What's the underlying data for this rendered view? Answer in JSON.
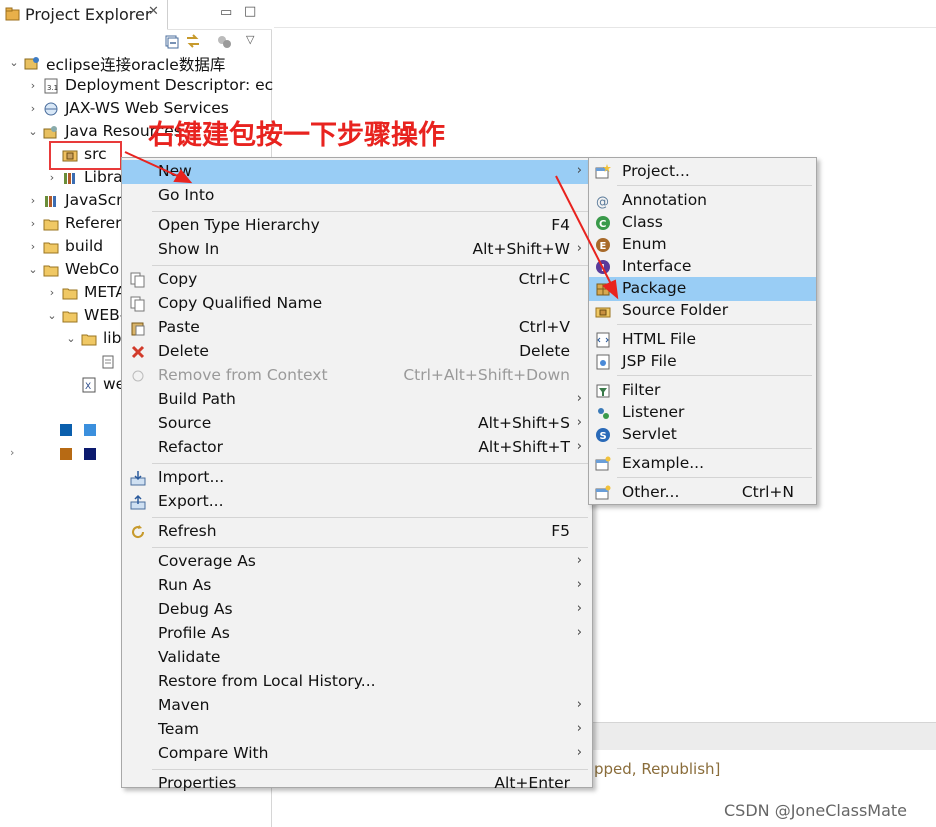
{
  "explorer": {
    "title": "Project Explorer",
    "close_glyph": "✕",
    "minimize_glyph": "▭",
    "maximize_glyph": "□"
  },
  "tree": [
    {
      "label": "eclipse连接oracle数据库",
      "icon": "project-icon",
      "expanded": true
    },
    {
      "label": "Deployment Descriptor: ecl",
      "icon": "descriptor-icon",
      "expanded": false
    },
    {
      "label": "JAX-WS Web Services",
      "icon": "webservices-icon",
      "expanded": false
    },
    {
      "label": "Java Resources",
      "icon": "java-resources-icon",
      "expanded": true
    },
    {
      "label": "src",
      "icon": "package-folder-icon"
    },
    {
      "label": "Libra",
      "icon": "library-icon",
      "expanded": false
    },
    {
      "label": "JavaScr",
      "icon": "library-icon",
      "expanded": false
    },
    {
      "label": "Referer",
      "icon": "folder-icon",
      "expanded": false
    },
    {
      "label": "build",
      "icon": "folder-icon",
      "expanded": false
    },
    {
      "label": "WebCo",
      "icon": "folder-icon",
      "expanded": true
    },
    {
      "label": "META",
      "icon": "folder-icon",
      "expanded": false
    },
    {
      "label": "WEB-",
      "icon": "folder-icon",
      "expanded": true
    },
    {
      "label": "lib",
      "icon": "folder-icon",
      "expanded": true
    },
    {
      "label": "",
      "icon": "jar-icon"
    },
    {
      "label": "we",
      "icon": "xml-file-icon"
    }
  ],
  "annotation": {
    "text": "右键建包按一下步骤操作",
    "color": "#e8231f"
  },
  "main_menu": [
    {
      "label": "New",
      "shortcut": "",
      "submenu": true,
      "highlighted": true,
      "icon": ""
    },
    {
      "label": "Go Into",
      "shortcut": "",
      "submenu": false,
      "icon": ""
    },
    {
      "sep": true
    },
    {
      "label": "Open Type Hierarchy",
      "shortcut": "F4",
      "submenu": false,
      "icon": ""
    },
    {
      "label": "Show In",
      "shortcut": "Alt+Shift+W",
      "submenu": true,
      "icon": ""
    },
    {
      "sep": true
    },
    {
      "label": "Copy",
      "shortcut": "Ctrl+C",
      "submenu": false,
      "icon": "copy-icon"
    },
    {
      "label": "Copy Qualified Name",
      "shortcut": "",
      "submenu": false,
      "icon": "copy-icon"
    },
    {
      "label": "Paste",
      "shortcut": "Ctrl+V",
      "submenu": false,
      "icon": "paste-icon"
    },
    {
      "label": "Delete",
      "shortcut": "Delete",
      "submenu": false,
      "icon": "delete-icon"
    },
    {
      "label": "Remove from Context",
      "shortcut": "Ctrl+Alt+Shift+Down",
      "submenu": false,
      "disabled": true,
      "icon": "remove-context-icon"
    },
    {
      "label": "Build Path",
      "shortcut": "",
      "submenu": true,
      "icon": ""
    },
    {
      "label": "Source",
      "shortcut": "Alt+Shift+S",
      "submenu": true,
      "icon": ""
    },
    {
      "label": "Refactor",
      "shortcut": "Alt+Shift+T",
      "submenu": true,
      "icon": ""
    },
    {
      "sep": true
    },
    {
      "label": "Import...",
      "shortcut": "",
      "submenu": false,
      "icon": "import-icon"
    },
    {
      "label": "Export...",
      "shortcut": "",
      "submenu": false,
      "icon": "export-icon"
    },
    {
      "sep": true
    },
    {
      "label": "Refresh",
      "shortcut": "F5",
      "submenu": false,
      "icon": "refresh-icon"
    },
    {
      "sep": true
    },
    {
      "label": "Coverage As",
      "shortcut": "",
      "submenu": true,
      "icon": ""
    },
    {
      "label": "Run As",
      "shortcut": "",
      "submenu": true,
      "icon": ""
    },
    {
      "label": "Debug As",
      "shortcut": "",
      "submenu": true,
      "icon": ""
    },
    {
      "label": "Profile As",
      "shortcut": "",
      "submenu": true,
      "icon": ""
    },
    {
      "label": "Validate",
      "shortcut": "",
      "submenu": false,
      "icon": ""
    },
    {
      "label": "Restore from Local History...",
      "shortcut": "",
      "submenu": false,
      "icon": ""
    },
    {
      "label": "Maven",
      "shortcut": "",
      "submenu": true,
      "icon": ""
    },
    {
      "label": "Team",
      "shortcut": "",
      "submenu": true,
      "icon": ""
    },
    {
      "label": "Compare With",
      "shortcut": "",
      "submenu": true,
      "icon": ""
    },
    {
      "sep": true
    },
    {
      "label": "Properties",
      "shortcut": "Alt+Enter",
      "submenu": false,
      "icon": ""
    }
  ],
  "sub_menu": [
    {
      "label": "Project...",
      "shortcut": "",
      "icon": "new-project-icon"
    },
    {
      "sep": true
    },
    {
      "label": "Annotation",
      "shortcut": "",
      "icon": "annotation-icon"
    },
    {
      "label": "Class",
      "shortcut": "",
      "icon": "class-icon"
    },
    {
      "label": "Enum",
      "shortcut": "",
      "icon": "enum-icon"
    },
    {
      "label": "Interface",
      "shortcut": "",
      "icon": "interface-icon"
    },
    {
      "label": "Package",
      "shortcut": "",
      "icon": "package-icon",
      "highlighted": true
    },
    {
      "label": "Source Folder",
      "shortcut": "",
      "icon": "source-folder-icon"
    },
    {
      "sep": true
    },
    {
      "label": "HTML File",
      "shortcut": "",
      "icon": "html-file-icon"
    },
    {
      "label": "JSP File",
      "shortcut": "",
      "icon": "jsp-file-icon"
    },
    {
      "sep": true
    },
    {
      "label": "Filter",
      "shortcut": "",
      "icon": "filter-icon"
    },
    {
      "label": "Listener",
      "shortcut": "",
      "icon": "listener-icon"
    },
    {
      "label": "Servlet",
      "shortcut": "",
      "icon": "servlet-icon"
    },
    {
      "sep": true
    },
    {
      "label": "Example...",
      "shortcut": "",
      "icon": "example-icon"
    },
    {
      "sep": true
    },
    {
      "label": "Other...",
      "shortcut": "Ctrl+N",
      "icon": "other-icon"
    }
  ],
  "console": {
    "text": "pped, Republish]"
  },
  "watermark": "CSDN @JoneClassMate",
  "colors": {
    "menu_highlight": "#99cdf5",
    "menu_background": "#f2f2f2",
    "annotation_red": "#e8231f"
  }
}
